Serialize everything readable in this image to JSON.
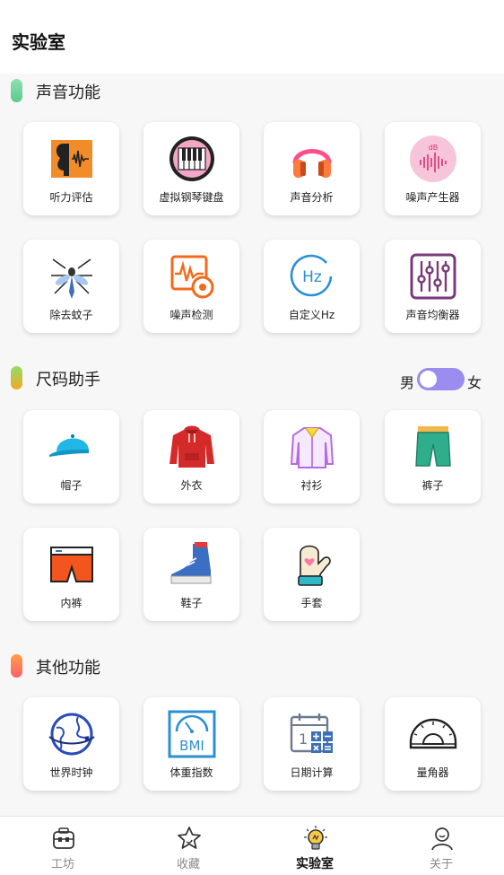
{
  "header": {
    "title": "实验室"
  },
  "sections": {
    "sound": {
      "title": "声音功能",
      "bar_color": "#7ed6a3",
      "items": [
        {
          "label": "听力评估",
          "icon": "hearing-test-icon"
        },
        {
          "label": "虚拟钢琴键盘",
          "icon": "piano-keyboard-icon"
        },
        {
          "label": "声音分析",
          "icon": "headphones-icon"
        },
        {
          "label": "噪声产生器",
          "icon": "db-waveform-icon"
        },
        {
          "label": "除去蚊子",
          "icon": "mosquito-icon"
        },
        {
          "label": "噪声检测",
          "icon": "noise-meter-icon"
        },
        {
          "label": "自定义Hz",
          "icon": "hz-icon"
        },
        {
          "label": "声音均衡器",
          "icon": "equalizer-icon"
        }
      ]
    },
    "size": {
      "title": "尺码助手",
      "bar_color": "#f5a623",
      "gender_male": "男",
      "gender_female": "女",
      "toggle_color": "#9b8cf0",
      "items": [
        {
          "label": "帽子",
          "icon": "cap-icon"
        },
        {
          "label": "外衣",
          "icon": "hoodie-icon"
        },
        {
          "label": "衬衫",
          "icon": "shirt-icon"
        },
        {
          "label": "裤子",
          "icon": "shorts-icon"
        },
        {
          "label": "内裤",
          "icon": "underwear-icon"
        },
        {
          "label": "鞋子",
          "icon": "sneaker-icon"
        },
        {
          "label": "手套",
          "icon": "mitten-icon"
        }
      ]
    },
    "other": {
      "title": "其他功能",
      "bar_color": "#ff6b6b",
      "items": [
        {
          "label": "世界时钟",
          "icon": "globe-icon"
        },
        {
          "label": "体重指数",
          "icon": "bmi-scale-icon"
        },
        {
          "label": "日期计算",
          "icon": "calendar-calculator-icon"
        },
        {
          "label": "量角器",
          "icon": "protractor-icon"
        }
      ]
    }
  },
  "bottom_nav": {
    "items": [
      {
        "label": "工坊",
        "icon": "toolbox-icon",
        "active": false
      },
      {
        "label": "收藏",
        "icon": "star-icon",
        "active": false
      },
      {
        "label": "实验室",
        "icon": "lightbulb-icon",
        "active": true
      },
      {
        "label": "关于",
        "icon": "person-icon",
        "active": false
      }
    ]
  }
}
